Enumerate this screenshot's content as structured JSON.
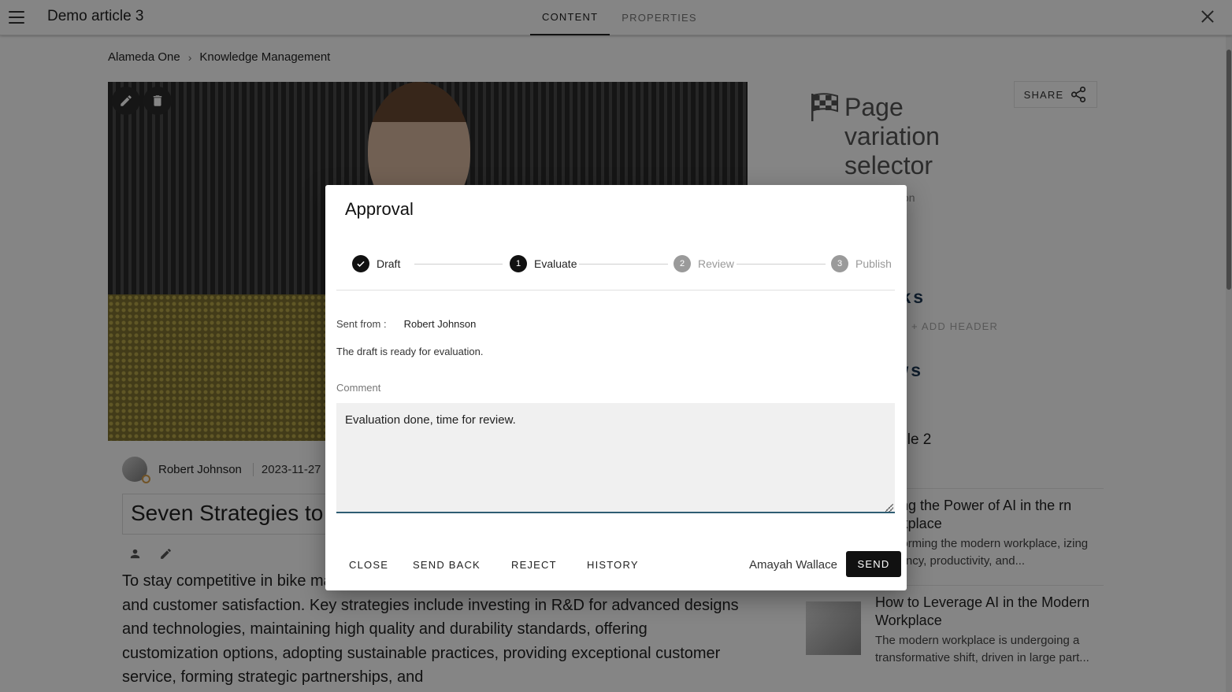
{
  "appbar": {
    "title": "Demo article 3",
    "tabs": [
      {
        "label": "CONTENT",
        "active": true
      },
      {
        "label": "PROPERTIES",
        "active": false
      }
    ]
  },
  "breadcrumb": [
    "Alameda One",
    "Knowledge Management"
  ],
  "breadcrumb_separator": "›",
  "article": {
    "author": "Robert Johnson",
    "date": "2023-11-27",
    "title": "Seven Strategies to",
    "body": "To stay competitive in bike manufacturing, companies must focus on innovation, quality, and customer satisfaction. Key strategies include investing in R&D for advanced designs and technologies, maintaining high quality and durability standards, offering customization options, adopting sustainable practices, providing exceptional customer service, forming strategic partnerships, and"
  },
  "sidebar": {
    "share_label": "SHARE",
    "page_variation_title": "Page variation selector",
    "page_variation_desc": "or end ariation",
    "links_heading": "Links",
    "add_header_label": "+ ADD HEADER",
    "news_heading_1": "News",
    "news_heading_2": "ews",
    "demo_link": "o article 2",
    "news_items": [
      {
        "title": "essing the Power of AI in the rn Workplace",
        "text": "ransforming the modern workplace, izing efficiency, productivity, and..."
      },
      {
        "title": "How to Leverage AI in the Modern Workplace",
        "text": "The modern workplace is undergoing a transformative shift, driven in large part..."
      }
    ]
  },
  "dialog": {
    "title": "Approval",
    "steps": [
      {
        "label": "Draft",
        "state": "done",
        "number": ""
      },
      {
        "label": "Evaluate",
        "state": "active",
        "number": "1"
      },
      {
        "label": "Review",
        "state": "pending",
        "number": "2"
      },
      {
        "label": "Publish",
        "state": "pending",
        "number": "3"
      }
    ],
    "sent_from_label": "Sent from :",
    "sent_from_value": "Robert Johnson",
    "message": "The draft is ready for evaluation.",
    "comment_label": "Comment",
    "comment_value": "Evaluation done, time for review.",
    "buttons": {
      "close": "CLOSE",
      "send_back": "SEND BACK",
      "reject": "REJECT",
      "history": "HISTORY",
      "send": "SEND"
    },
    "assignee": "Amayah Wallace"
  },
  "colors": {
    "accent_dark": "#111111",
    "heading_blue": "#1f3b57",
    "input_underline": "#2e5d73",
    "scrim": "rgba(0,0,0,0.48)"
  }
}
